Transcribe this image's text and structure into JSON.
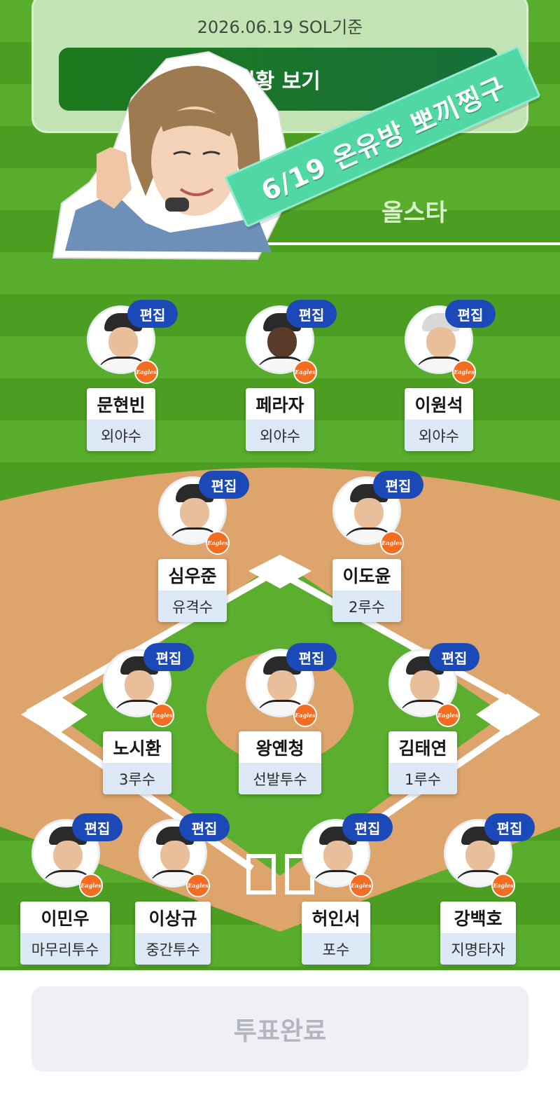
{
  "header": {
    "date_basis": "2026.06.19 SOL기준",
    "status_button": "현황 보기",
    "allstar_label": "올스타"
  },
  "banner": {
    "text": "6/19 온유방 뽀끼찡구"
  },
  "players": {
    "lf": {
      "name": "문현빈",
      "position": "외야수",
      "edit": "편집"
    },
    "cf": {
      "name": "페라자",
      "position": "외야수",
      "edit": "편집"
    },
    "rf": {
      "name": "이원석",
      "position": "외야수",
      "edit": "편집"
    },
    "ss": {
      "name": "심우준",
      "position": "유격수",
      "edit": "편집"
    },
    "second": {
      "name": "이도윤",
      "position": "2루수",
      "edit": "편집"
    },
    "third": {
      "name": "노시환",
      "position": "3루수",
      "edit": "편집"
    },
    "sp": {
      "name": "왕옌청",
      "position": "선발투수",
      "edit": "편집"
    },
    "first": {
      "name": "김태연",
      "position": "1루수",
      "edit": "편집"
    },
    "cl": {
      "name": "이민우",
      "position": "마무리투수",
      "edit": "편집"
    },
    "rp": {
      "name": "이상규",
      "position": "중간투수",
      "edit": "편집"
    },
    "c": {
      "name": "허인서",
      "position": "포수",
      "edit": "편집"
    },
    "dh": {
      "name": "강백호",
      "position": "지명타자",
      "edit": "편집"
    }
  },
  "team_badge": "Eagles",
  "footer": {
    "vote_done": "투표완료"
  },
  "colors": {
    "edit": "#1c49b8",
    "team": "#f26c22",
    "grass": "#58ae2c",
    "dirt": "#dda46c",
    "banner": "#51d7a3"
  }
}
